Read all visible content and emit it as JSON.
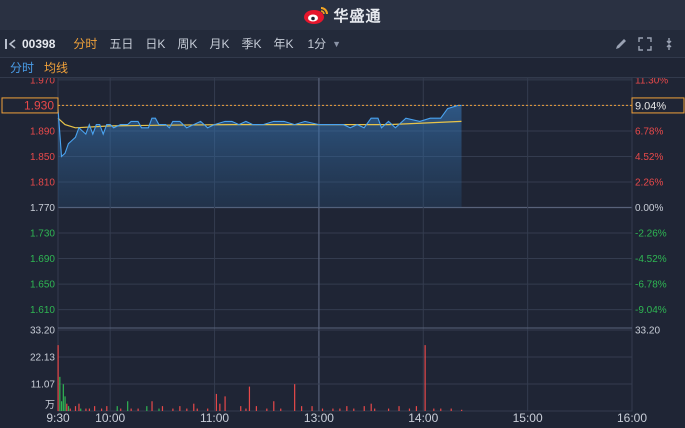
{
  "header": {
    "brand": "华盛通"
  },
  "toolbar": {
    "code": "00398",
    "periods": [
      "分时",
      "五日",
      "日K",
      "周K",
      "月K",
      "季K",
      "年K"
    ],
    "active_period": "分时",
    "interval": "1分"
  },
  "subtabs": {
    "minute": "分时",
    "avg": "均线"
  },
  "current": {
    "price": "1.930",
    "pct": "9.04%"
  },
  "chart_data": {
    "type": "line",
    "price_ticks": [
      "1.970",
      "1.930",
      "1.890",
      "1.850",
      "1.810",
      "1.770",
      "1.730",
      "1.690",
      "1.650",
      "1.610"
    ],
    "price_values": [
      1.97,
      1.93,
      1.89,
      1.85,
      1.81,
      1.77,
      1.73,
      1.69,
      1.65,
      1.61
    ],
    "pct_ticks": [
      "11.30%",
      "9.04%",
      "6.78%",
      "4.52%",
      "2.26%",
      "0.00%",
      "-2.26%",
      "-4.52%",
      "-6.78%",
      "-9.04%"
    ],
    "base_price": 1.77,
    "ylim": [
      1.589,
      1.973
    ],
    "x_ticks": [
      "9:30",
      "10:00",
      "11:00",
      "13:00",
      "14:00",
      "15:00",
      "16:00"
    ],
    "x_tick_minutes": [
      0,
      30,
      90,
      150,
      210,
      270,
      330
    ],
    "session_minutes": 330,
    "lunch_break_after_minute": 150,
    "price_series": [
      [
        0,
        1.925
      ],
      [
        2,
        1.85
      ],
      [
        4,
        1.855
      ],
      [
        6,
        1.87
      ],
      [
        8,
        1.875
      ],
      [
        10,
        1.88
      ],
      [
        12,
        1.895
      ],
      [
        14,
        1.89
      ],
      [
        16,
        1.885
      ],
      [
        18,
        1.9
      ],
      [
        20,
        1.885
      ],
      [
        22,
        1.9
      ],
      [
        24,
        1.9
      ],
      [
        26,
        1.885
      ],
      [
        28,
        1.9
      ],
      [
        30,
        1.9
      ],
      [
        32,
        1.895
      ],
      [
        36,
        1.9
      ],
      [
        40,
        1.9
      ],
      [
        42,
        1.905
      ],
      [
        46,
        1.905
      ],
      [
        48,
        1.895
      ],
      [
        52,
        1.895
      ],
      [
        54,
        1.91
      ],
      [
        56,
        1.91
      ],
      [
        58,
        1.9
      ],
      [
        62,
        1.9
      ],
      [
        64,
        1.895
      ],
      [
        66,
        1.905
      ],
      [
        70,
        1.905
      ],
      [
        74,
        1.895
      ],
      [
        78,
        1.9
      ],
      [
        82,
        1.905
      ],
      [
        86,
        1.895
      ],
      [
        90,
        1.9
      ],
      [
        96,
        1.905
      ],
      [
        100,
        1.905
      ],
      [
        104,
        1.9
      ],
      [
        108,
        1.905
      ],
      [
        112,
        1.9
      ],
      [
        118,
        1.9
      ],
      [
        124,
        1.905
      ],
      [
        130,
        1.905
      ],
      [
        136,
        1.9
      ],
      [
        142,
        1.905
      ],
      [
        150,
        1.9
      ],
      [
        158,
        1.9
      ],
      [
        164,
        1.9
      ],
      [
        168,
        1.895
      ],
      [
        172,
        1.9
      ],
      [
        176,
        1.895
      ],
      [
        180,
        1.91
      ],
      [
        184,
        1.91
      ],
      [
        186,
        1.895
      ],
      [
        190,
        1.905
      ],
      [
        194,
        1.895
      ],
      [
        200,
        1.91
      ],
      [
        208,
        1.905
      ],
      [
        214,
        1.91
      ],
      [
        220,
        1.91
      ],
      [
        224,
        1.925
      ],
      [
        230,
        1.93
      ],
      [
        232,
        1.93
      ]
    ],
    "avg_series": [
      [
        0,
        1.91
      ],
      [
        4,
        1.9
      ],
      [
        10,
        1.895
      ],
      [
        30,
        1.898
      ],
      [
        60,
        1.899
      ],
      [
        100,
        1.9
      ],
      [
        150,
        1.9
      ],
      [
        190,
        1.9
      ],
      [
        232,
        1.905
      ]
    ],
    "volume_ticks": [
      "33.20",
      "22.13",
      "11.07"
    ],
    "volume_values": [
      33.2,
      22.13,
      11.07
    ],
    "volume_unit": "万",
    "volume_max": 33.2,
    "volume_bars": [
      [
        0,
        27,
        "r"
      ],
      [
        1,
        14,
        "g"
      ],
      [
        2,
        4,
        "g"
      ],
      [
        3,
        11,
        "g"
      ],
      [
        4,
        6,
        "g"
      ],
      [
        5,
        3,
        "r"
      ],
      [
        6,
        2,
        "g"
      ],
      [
        7,
        1,
        "r"
      ],
      [
        10,
        2,
        "r"
      ],
      [
        12,
        3,
        "r"
      ],
      [
        13,
        1,
        "g"
      ],
      [
        16,
        1,
        "r"
      ],
      [
        18,
        1,
        "r"
      ],
      [
        21,
        2,
        "r"
      ],
      [
        25,
        1,
        "r"
      ],
      [
        28,
        2,
        "r"
      ],
      [
        34,
        2,
        "g"
      ],
      [
        36,
        1,
        "r"
      ],
      [
        40,
        4,
        "g"
      ],
      [
        42,
        1,
        "r"
      ],
      [
        46,
        1,
        "r"
      ],
      [
        51,
        2,
        "g"
      ],
      [
        54,
        4,
        "r"
      ],
      [
        58,
        1,
        "g"
      ],
      [
        60,
        2,
        "r"
      ],
      [
        66,
        1,
        "r"
      ],
      [
        70,
        2,
        "r"
      ],
      [
        74,
        1,
        "r"
      ],
      [
        78,
        3,
        "r"
      ],
      [
        80,
        1,
        "r"
      ],
      [
        86,
        1,
        "r"
      ],
      [
        91,
        7,
        "r"
      ],
      [
        93,
        3,
        "r"
      ],
      [
        96,
        6,
        "r"
      ],
      [
        105,
        2,
        "r"
      ],
      [
        108,
        1,
        "r"
      ],
      [
        110,
        10,
        "r"
      ],
      [
        114,
        2,
        "r"
      ],
      [
        120,
        1,
        "r"
      ],
      [
        124,
        4,
        "r"
      ],
      [
        128,
        1,
        "r"
      ],
      [
        136,
        11,
        "r"
      ],
      [
        140,
        2,
        "r"
      ],
      [
        146,
        2,
        "r"
      ],
      [
        152,
        1,
        "r"
      ],
      [
        158,
        1,
        "r"
      ],
      [
        162,
        1,
        "r"
      ],
      [
        166,
        2,
        "r"
      ],
      [
        170,
        1,
        "r"
      ],
      [
        176,
        2,
        "r"
      ],
      [
        180,
        3,
        "r"
      ],
      [
        182,
        1,
        "r"
      ],
      [
        190,
        1,
        "r"
      ],
      [
        196,
        2,
        "r"
      ],
      [
        202,
        1,
        "r"
      ],
      [
        206,
        2,
        "r"
      ],
      [
        211,
        27,
        "r"
      ],
      [
        216,
        1,
        "r"
      ],
      [
        220,
        1,
        "r"
      ],
      [
        226,
        1,
        "r"
      ],
      [
        232,
        0.5,
        "r"
      ]
    ]
  },
  "colors": {
    "up": "#e8494a",
    "down": "#2fb653",
    "price_line": "#4aa3f0",
    "avg_line": "#e8c44a",
    "accent": "#f0a13a",
    "grid": "#343c4f",
    "mid_line": "#58627a"
  }
}
